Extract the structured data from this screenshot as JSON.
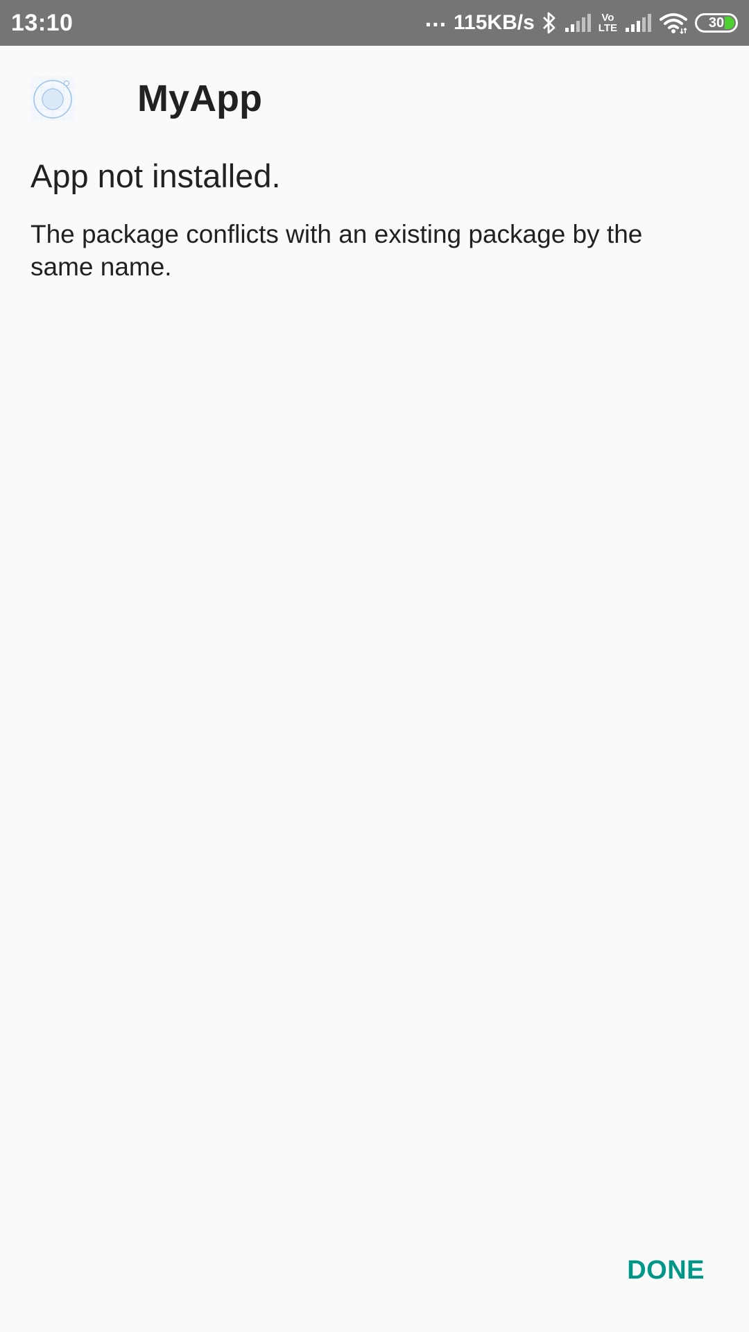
{
  "status_bar": {
    "time": "13:10",
    "more_indicator": "...",
    "network_speed": "115KB/s",
    "volte_line1": "Vo",
    "volte_line2": "LTE",
    "battery_level": "30",
    "icons": [
      "bluetooth-icon",
      "signal-icon",
      "volte-icon",
      "signal-icon",
      "wifi-icon",
      "battery-icon"
    ]
  },
  "app": {
    "name": "MyApp",
    "icon": "app-icon"
  },
  "result": {
    "title": "App not installed.",
    "message": "The package conflicts with an existing package by the same name."
  },
  "actions": {
    "done_label": "DONE"
  },
  "colors": {
    "status_bar_bg": "#757575",
    "background": "#fafafa",
    "accent": "#009688",
    "battery_fill": "#4cd130"
  }
}
